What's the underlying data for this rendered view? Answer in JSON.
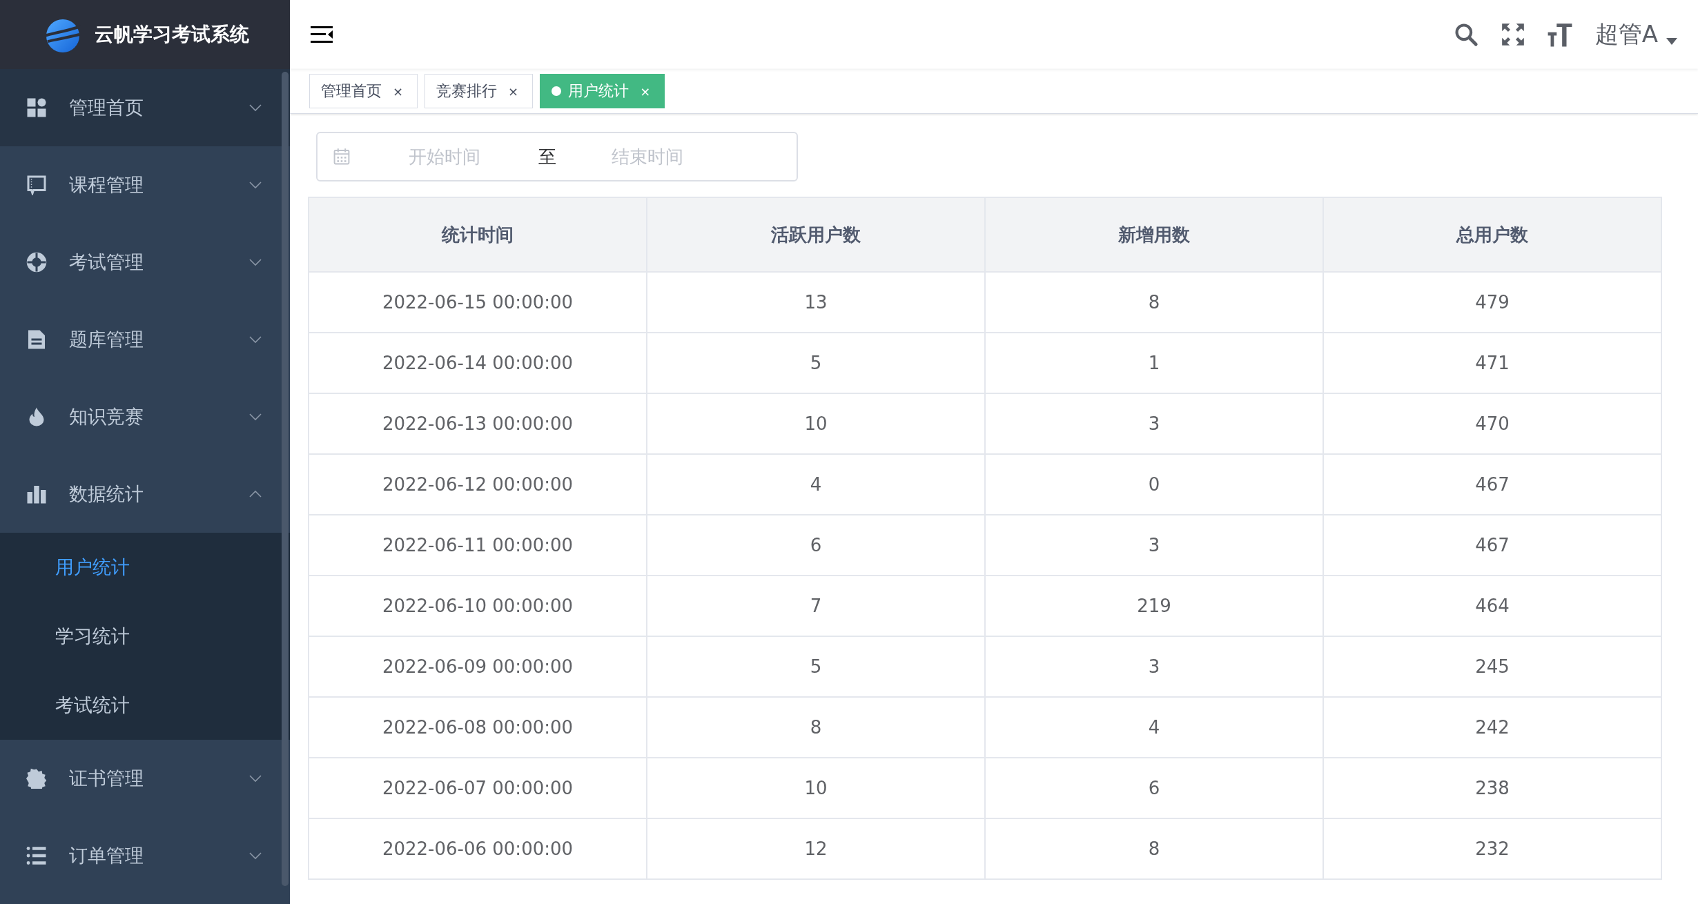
{
  "sidebar": {
    "logo_text": "云帆学习考试系统",
    "items": [
      {
        "label": "管理首页",
        "expanded": false,
        "hovered": true
      },
      {
        "label": "课程管理",
        "expanded": false,
        "hovered": false
      },
      {
        "label": "考试管理",
        "expanded": false,
        "hovered": false
      },
      {
        "label": "题库管理",
        "expanded": false,
        "hovered": false
      },
      {
        "label": "知识竞赛",
        "expanded": false,
        "hovered": false
      },
      {
        "label": "数据统计",
        "expanded": true,
        "hovered": false,
        "children": [
          {
            "label": "用户统计",
            "selected": true
          },
          {
            "label": "学习统计",
            "selected": false
          },
          {
            "label": "考试统计",
            "selected": false
          }
        ]
      },
      {
        "label": "证书管理",
        "expanded": false,
        "hovered": false
      },
      {
        "label": "订单管理",
        "expanded": false,
        "hovered": false
      }
    ]
  },
  "header": {
    "user": "超管A"
  },
  "tabs": [
    {
      "label": "管理首页",
      "selected": false,
      "close": "×"
    },
    {
      "label": "竞赛排行",
      "selected": false,
      "close": "×"
    },
    {
      "label": "用户统计",
      "selected": true,
      "close": "×"
    }
  ],
  "date_range": {
    "start_placeholder": "开始时间",
    "separator": "至",
    "end_placeholder": "结束时间"
  },
  "table": {
    "columns": [
      "统计时间",
      "活跃用户数",
      "新增用数",
      "总用户数"
    ],
    "rows": [
      [
        "2022-06-15 00:00:00",
        "13",
        "8",
        "479"
      ],
      [
        "2022-06-14 00:00:00",
        "5",
        "1",
        "471"
      ],
      [
        "2022-06-13 00:00:00",
        "10",
        "3",
        "470"
      ],
      [
        "2022-06-12 00:00:00",
        "4",
        "0",
        "467"
      ],
      [
        "2022-06-11 00:00:00",
        "6",
        "3",
        "467"
      ],
      [
        "2022-06-10 00:00:00",
        "7",
        "219",
        "464"
      ],
      [
        "2022-06-09 00:00:00",
        "5",
        "3",
        "245"
      ],
      [
        "2022-06-08 00:00:00",
        "8",
        "4",
        "242"
      ],
      [
        "2022-06-07 00:00:00",
        "10",
        "6",
        "238"
      ],
      [
        "2022-06-06 00:00:00",
        "12",
        "8",
        "232"
      ]
    ]
  }
}
